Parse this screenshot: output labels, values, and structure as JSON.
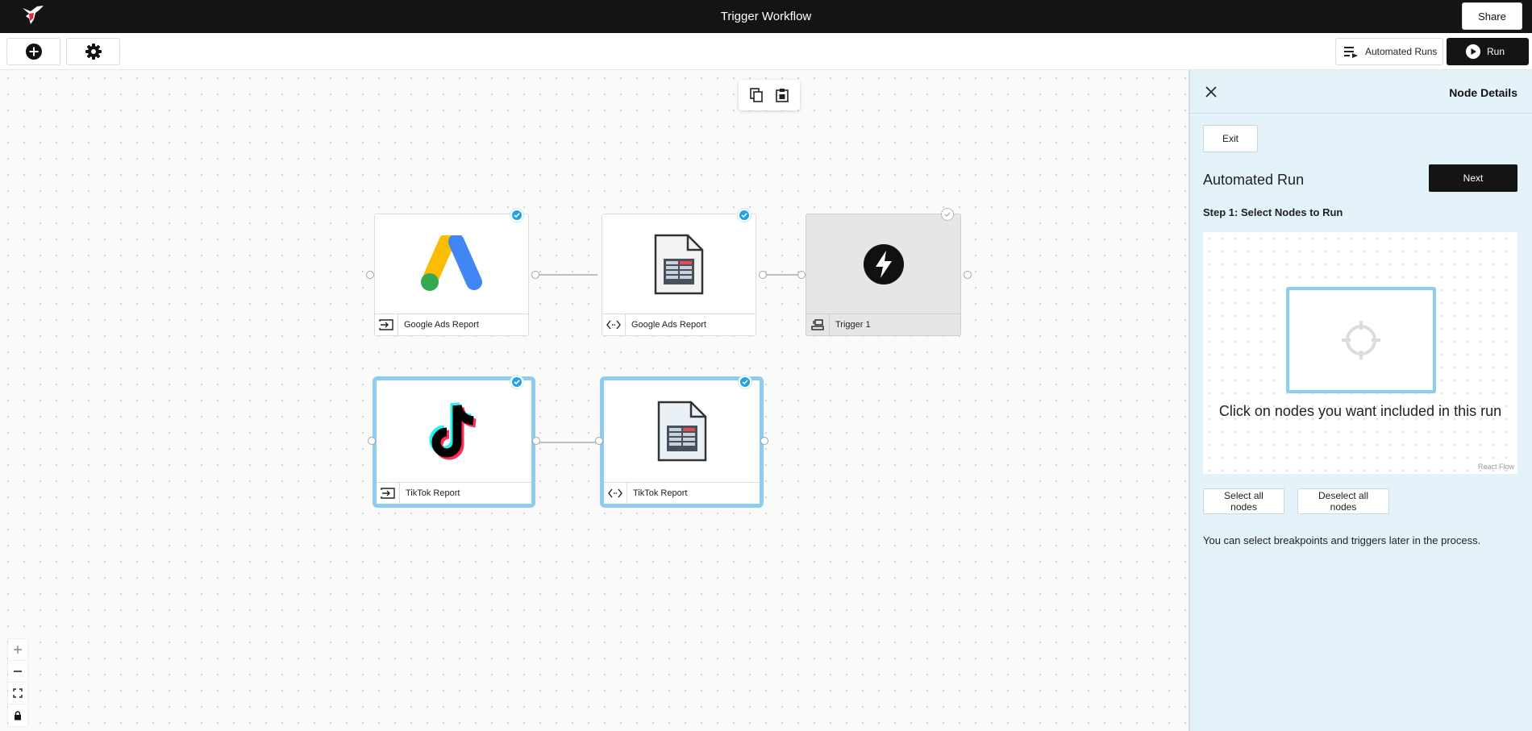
{
  "app": {
    "title": "Trigger Workflow",
    "share_label": "Share"
  },
  "toolbar": {
    "automated_runs_label": "Automated Runs",
    "run_label": "Run"
  },
  "nodes": {
    "google_ads_input": {
      "label": "Google Ads Report"
    },
    "google_ads_transform": {
      "label": "Google Ads Report"
    },
    "trigger": {
      "label": "Trigger 1"
    },
    "tiktok_input": {
      "label": "TikTok Report"
    },
    "tiktok_transform": {
      "label": "TikTok Report"
    }
  },
  "panel": {
    "title": "Node Details",
    "exit_label": "Exit",
    "heading": "Automated Run",
    "next_label": "Next",
    "step_label": "Step 1: Select Nodes to Run",
    "mini_flow_message": "Click on nodes you want included in this run",
    "react_flow_attribution": "React Flow",
    "select_all_label": "Select all nodes",
    "deselect_all_label": "Deselect all nodes",
    "hint": "You can select breakpoints and triggers later in the process."
  },
  "colors": {
    "accent_blue": "#22a1e6",
    "selection_outline": "#8ecdee",
    "panel_background": "#e4f2fa",
    "dark": "#141414"
  },
  "icons": [
    "hummingbird-logo-icon",
    "plus-circle-icon",
    "gear-icon",
    "list-play-icon",
    "play-icon",
    "copy-icon",
    "paste-icon",
    "google-ads-icon",
    "spreadsheet-file-icon",
    "lightning-icon",
    "tiktok-icon",
    "input-arrow-icon",
    "code-icon",
    "trigger-icon",
    "check-icon",
    "close-icon",
    "crosshair-icon",
    "zoom-in-icon",
    "zoom-out-icon",
    "fit-view-icon",
    "lock-icon"
  ]
}
